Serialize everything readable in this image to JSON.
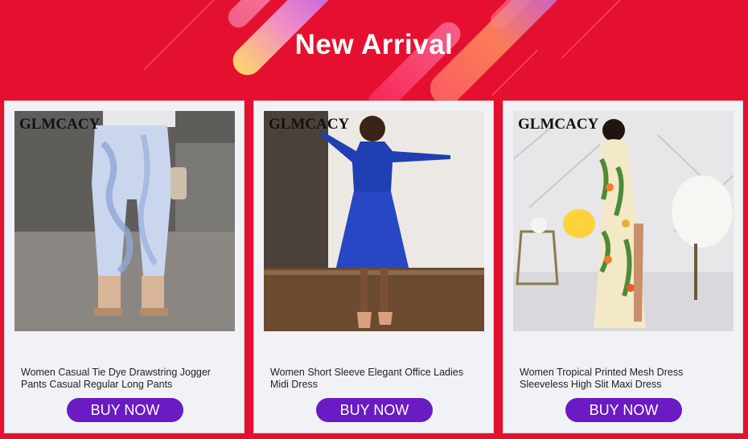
{
  "banner": {
    "title": "New Arrival",
    "background_color": "#e5102f"
  },
  "products": [
    {
      "brand": "GLMCACY",
      "name": "Women Casual Tie Dye Drawstring Jogger Pants Casual Regular Long Pants",
      "button_label": "BUY NOW"
    },
    {
      "brand": "GLMCACY",
      "name": "Women Short Sleeve Elegant Office Ladies Midi Dress",
      "button_label": "BUY NOW"
    },
    {
      "brand": "GLMCACY",
      "name": "Women Tropical Printed Mesh Dress Sleeveless High Slit Maxi Dress",
      "button_label": "BUY NOW"
    }
  ],
  "colors": {
    "button": "#6a1bc3",
    "card": "#f1f2f5"
  }
}
